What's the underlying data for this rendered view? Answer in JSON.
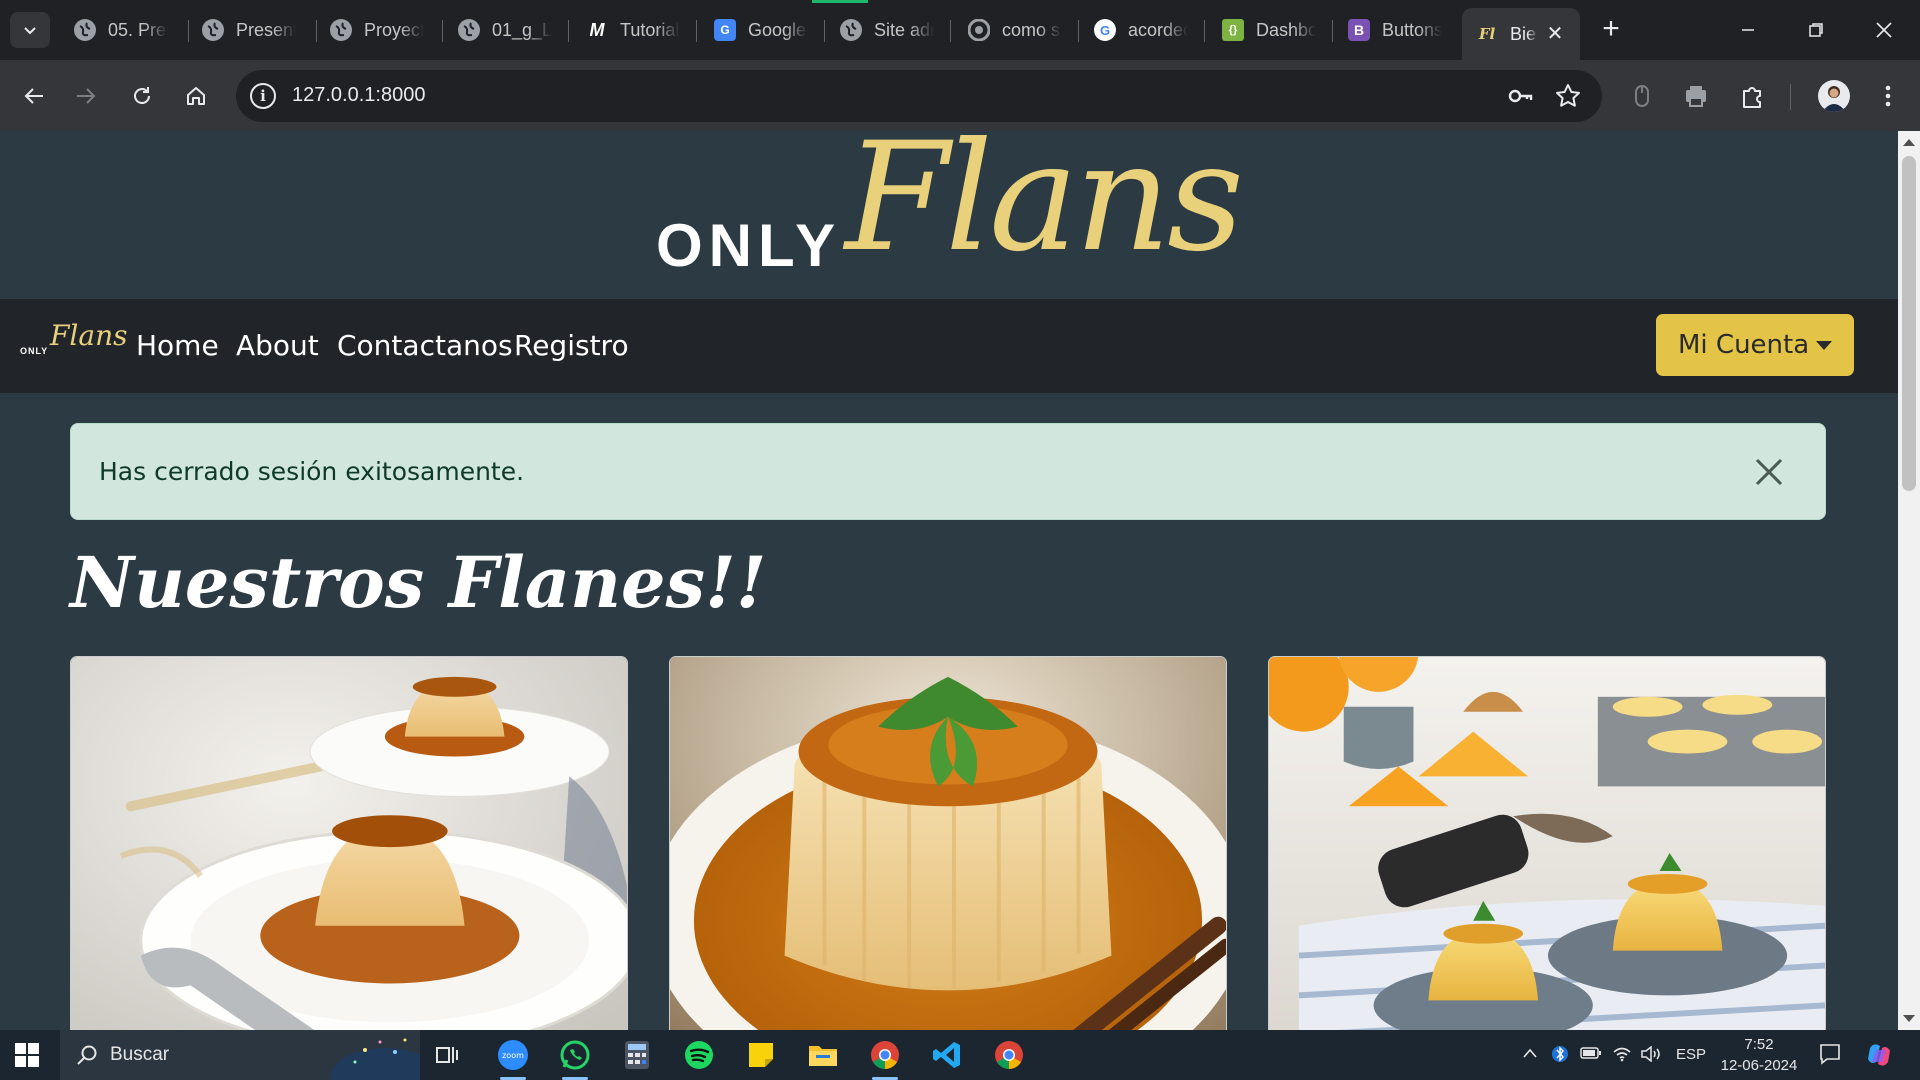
{
  "browser": {
    "tabs": [
      {
        "title": "05. Pres",
        "icon": "globe-icon"
      },
      {
        "title": "Present",
        "icon": "globe-icon"
      },
      {
        "title": "Proyect",
        "icon": "globe-icon"
      },
      {
        "title": "01_g_Le",
        "icon": "globe-icon"
      },
      {
        "title": "Tutorial",
        "icon": "m-logo-icon"
      },
      {
        "title": "Google",
        "icon": "google-translate-icon"
      },
      {
        "title": "Site adr",
        "icon": "globe-icon"
      },
      {
        "title": "como s",
        "icon": "chrome-icon"
      },
      {
        "title": "acordeo",
        "icon": "google-icon"
      },
      {
        "title": "Dashbo",
        "icon": "json-icon"
      },
      {
        "title": "Buttons",
        "icon": "bootstrap-icon"
      },
      {
        "title": "Bie",
        "icon": "onlyflans-icon",
        "active": true
      }
    ],
    "url": "127.0.0.1:8000"
  },
  "site": {
    "logo": {
      "only": "ONLY",
      "flans": "Flans"
    },
    "nav": {
      "brand_only": "ONLY",
      "brand_flans": "Flans",
      "links": [
        "Home",
        "About",
        "Contactanos",
        "Registro"
      ],
      "account_button": "Mi Cuenta"
    },
    "alert": {
      "message": "Has cerrado sesión exitosamente."
    },
    "section_title": "Nuestros Flanes!!",
    "cards": [
      {
        "image": "flan-with-spoon-and-wheat"
      },
      {
        "image": "flan-with-mint-and-cinnamon"
      },
      {
        "image": "flans-with-oranges"
      }
    ]
  },
  "taskbar": {
    "search_label": "Buscar",
    "apps": [
      "zoom-icon",
      "whatsapp-icon",
      "calculator-icon",
      "spotify-icon",
      "sticky-notes-icon",
      "file-explorer-icon",
      "chrome-icon",
      "vscode-icon",
      "chrome-profile-icon"
    ],
    "language": "ESP",
    "time": "7:52",
    "date": "12-06-2024"
  },
  "colors": {
    "page_bg": "#2b3a43",
    "navbar_bg": "#212529",
    "accent_gold": "#e3c447",
    "logo_gold": "#e9d07a",
    "alert_bg": "#d1e7dd"
  }
}
